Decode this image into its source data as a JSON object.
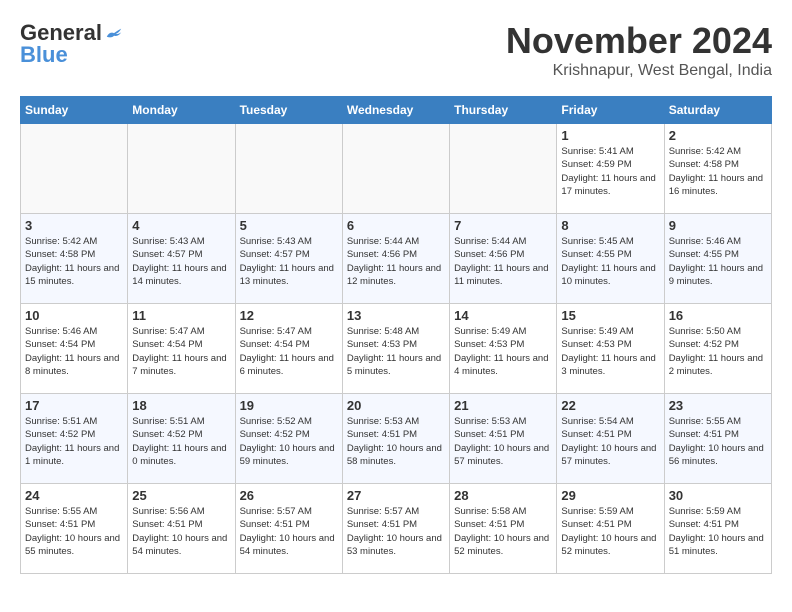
{
  "header": {
    "logo_line1": "General",
    "logo_line2": "Blue",
    "month": "November 2024",
    "location": "Krishnapur, West Bengal, India"
  },
  "weekdays": [
    "Sunday",
    "Monday",
    "Tuesday",
    "Wednesday",
    "Thursday",
    "Friday",
    "Saturday"
  ],
  "weeks": [
    [
      {
        "day": "",
        "info": ""
      },
      {
        "day": "",
        "info": ""
      },
      {
        "day": "",
        "info": ""
      },
      {
        "day": "",
        "info": ""
      },
      {
        "day": "",
        "info": ""
      },
      {
        "day": "1",
        "info": "Sunrise: 5:41 AM\nSunset: 4:59 PM\nDaylight: 11 hours and 17 minutes."
      },
      {
        "day": "2",
        "info": "Sunrise: 5:42 AM\nSunset: 4:58 PM\nDaylight: 11 hours and 16 minutes."
      }
    ],
    [
      {
        "day": "3",
        "info": "Sunrise: 5:42 AM\nSunset: 4:58 PM\nDaylight: 11 hours and 15 minutes."
      },
      {
        "day": "4",
        "info": "Sunrise: 5:43 AM\nSunset: 4:57 PM\nDaylight: 11 hours and 14 minutes."
      },
      {
        "day": "5",
        "info": "Sunrise: 5:43 AM\nSunset: 4:57 PM\nDaylight: 11 hours and 13 minutes."
      },
      {
        "day": "6",
        "info": "Sunrise: 5:44 AM\nSunset: 4:56 PM\nDaylight: 11 hours and 12 minutes."
      },
      {
        "day": "7",
        "info": "Sunrise: 5:44 AM\nSunset: 4:56 PM\nDaylight: 11 hours and 11 minutes."
      },
      {
        "day": "8",
        "info": "Sunrise: 5:45 AM\nSunset: 4:55 PM\nDaylight: 11 hours and 10 minutes."
      },
      {
        "day": "9",
        "info": "Sunrise: 5:46 AM\nSunset: 4:55 PM\nDaylight: 11 hours and 9 minutes."
      }
    ],
    [
      {
        "day": "10",
        "info": "Sunrise: 5:46 AM\nSunset: 4:54 PM\nDaylight: 11 hours and 8 minutes."
      },
      {
        "day": "11",
        "info": "Sunrise: 5:47 AM\nSunset: 4:54 PM\nDaylight: 11 hours and 7 minutes."
      },
      {
        "day": "12",
        "info": "Sunrise: 5:47 AM\nSunset: 4:54 PM\nDaylight: 11 hours and 6 minutes."
      },
      {
        "day": "13",
        "info": "Sunrise: 5:48 AM\nSunset: 4:53 PM\nDaylight: 11 hours and 5 minutes."
      },
      {
        "day": "14",
        "info": "Sunrise: 5:49 AM\nSunset: 4:53 PM\nDaylight: 11 hours and 4 minutes."
      },
      {
        "day": "15",
        "info": "Sunrise: 5:49 AM\nSunset: 4:53 PM\nDaylight: 11 hours and 3 minutes."
      },
      {
        "day": "16",
        "info": "Sunrise: 5:50 AM\nSunset: 4:52 PM\nDaylight: 11 hours and 2 minutes."
      }
    ],
    [
      {
        "day": "17",
        "info": "Sunrise: 5:51 AM\nSunset: 4:52 PM\nDaylight: 11 hours and 1 minute."
      },
      {
        "day": "18",
        "info": "Sunrise: 5:51 AM\nSunset: 4:52 PM\nDaylight: 11 hours and 0 minutes."
      },
      {
        "day": "19",
        "info": "Sunrise: 5:52 AM\nSunset: 4:52 PM\nDaylight: 10 hours and 59 minutes."
      },
      {
        "day": "20",
        "info": "Sunrise: 5:53 AM\nSunset: 4:51 PM\nDaylight: 10 hours and 58 minutes."
      },
      {
        "day": "21",
        "info": "Sunrise: 5:53 AM\nSunset: 4:51 PM\nDaylight: 10 hours and 57 minutes."
      },
      {
        "day": "22",
        "info": "Sunrise: 5:54 AM\nSunset: 4:51 PM\nDaylight: 10 hours and 57 minutes."
      },
      {
        "day": "23",
        "info": "Sunrise: 5:55 AM\nSunset: 4:51 PM\nDaylight: 10 hours and 56 minutes."
      }
    ],
    [
      {
        "day": "24",
        "info": "Sunrise: 5:55 AM\nSunset: 4:51 PM\nDaylight: 10 hours and 55 minutes."
      },
      {
        "day": "25",
        "info": "Sunrise: 5:56 AM\nSunset: 4:51 PM\nDaylight: 10 hours and 54 minutes."
      },
      {
        "day": "26",
        "info": "Sunrise: 5:57 AM\nSunset: 4:51 PM\nDaylight: 10 hours and 54 minutes."
      },
      {
        "day": "27",
        "info": "Sunrise: 5:57 AM\nSunset: 4:51 PM\nDaylight: 10 hours and 53 minutes."
      },
      {
        "day": "28",
        "info": "Sunrise: 5:58 AM\nSunset: 4:51 PM\nDaylight: 10 hours and 52 minutes."
      },
      {
        "day": "29",
        "info": "Sunrise: 5:59 AM\nSunset: 4:51 PM\nDaylight: 10 hours and 52 minutes."
      },
      {
        "day": "30",
        "info": "Sunrise: 5:59 AM\nSunset: 4:51 PM\nDaylight: 10 hours and 51 minutes."
      }
    ]
  ]
}
